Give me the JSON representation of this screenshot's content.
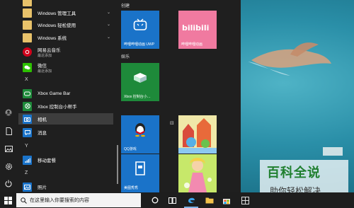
{
  "app_list": {
    "folders": [
      {
        "label": "Windows 管理工具"
      },
      {
        "label": "Windows 轻松使用"
      },
      {
        "label": "Windows 系统"
      }
    ],
    "apps": [
      {
        "label": "网易云音乐",
        "sublabel": "最近添加"
      },
      {
        "label": "微信",
        "sublabel": "最近添加"
      }
    ],
    "letters": [
      "X",
      "Y",
      "Z"
    ],
    "x_apps": [
      {
        "label": "Xbox Game Bar"
      },
      {
        "label": "Xbox 控制台小帮手"
      },
      {
        "label": "相机"
      },
      {
        "label": "消息"
      }
    ],
    "y_apps": [
      {
        "label": "移动套餐"
      }
    ],
    "z_apps": [
      {
        "label": "照片"
      }
    ]
  },
  "tiles": {
    "group_create": "创建",
    "group_play": "娱乐",
    "bili_uwp": "哔哩哔哩动画 UWP",
    "bili_logo": "bilibili",
    "bili": "哔哩哔哩动画",
    "xbox": "Xbox 控制台小…",
    "qq": "QQ游戏",
    "meitu": "美图秀秀"
  },
  "taskbar": {
    "search_placeholder": "在这里输入你要搜索的内容"
  },
  "brand": {
    "line1": "百科全说",
    "line2": "助你轻松解决"
  },
  "colors": {
    "tile_blue": "#1a73c9",
    "tile_pink": "#f07aa0",
    "tile_green": "#1e8a3a",
    "start_bg": "#1f1f1f",
    "taskbar_bg": "#1e1e1e"
  }
}
